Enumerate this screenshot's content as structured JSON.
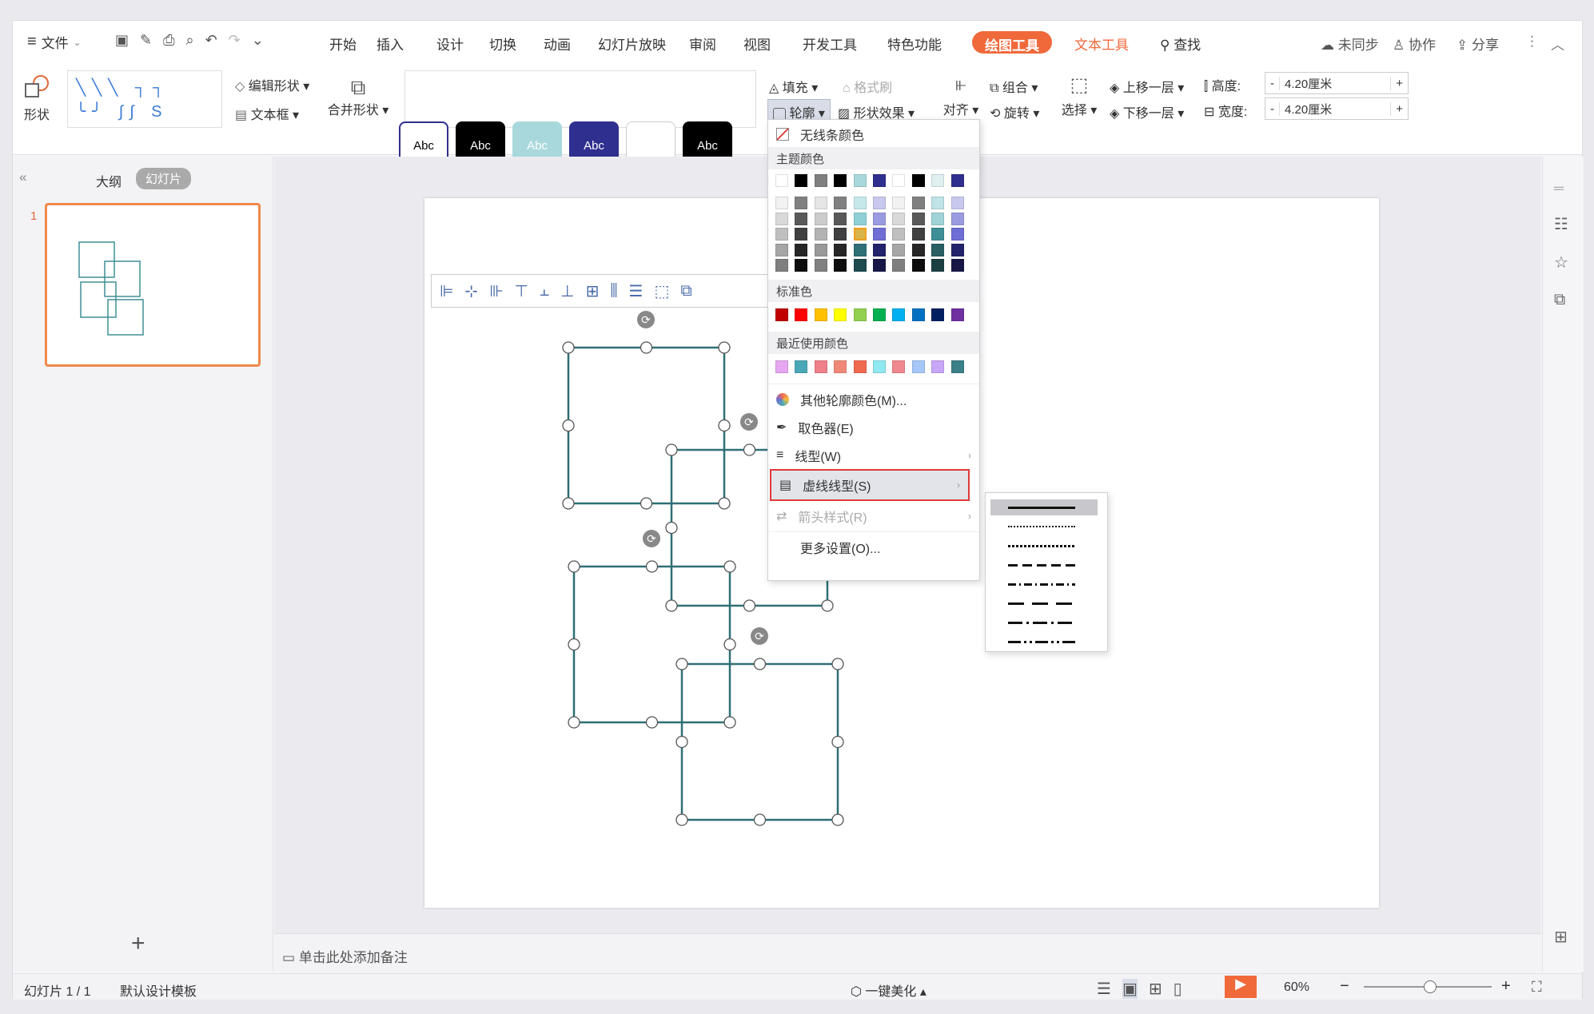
{
  "tabs": {
    "file": "文件",
    "items": [
      "开始",
      "插入",
      "设计",
      "切换",
      "动画",
      "幻灯片放映",
      "审阅",
      "视图",
      "开发工具",
      "特色功能"
    ],
    "drawing_tools": "绘图工具",
    "text_tools": "文本工具",
    "search": "查找",
    "unsync": "未同步",
    "collab": "协作",
    "share": "分享"
  },
  "ribbon": {
    "shape": "形状",
    "edit_shape": "编辑形状",
    "text_box": "文本框",
    "merge_shape": "合并形状",
    "style_label": "Abc",
    "fill": "填充",
    "format_painter": "格式刷",
    "outline": "轮廓",
    "shape_effect": "形状效果",
    "align": "对齐",
    "group": "组合",
    "rotate": "旋转",
    "select": "选择",
    "bring_forward": "上移一层",
    "send_backward": "下移一层",
    "height_label": "高度:",
    "width_label": "宽度:",
    "height_value": "4.20厘米",
    "width_value": "4.20厘米",
    "minus": "-",
    "plus": "+"
  },
  "style_colors": [
    "#ffffff",
    "#000000",
    "#a9d8dc",
    "#2f2f8f",
    "#ffffff",
    "#000000"
  ],
  "left_panel": {
    "outline_tab": "大纲",
    "slides_tab": "幻灯片",
    "slide_number": "1",
    "add": "+"
  },
  "notes_placeholder": "单击此处添加备注",
  "status": {
    "slide_count": "幻灯片 1 / 1",
    "template": "默认设计模板",
    "beautify": "一键美化",
    "zoom": "60%"
  },
  "outline_menu": {
    "no_line": "无线条颜色",
    "theme_colors": "主题颜色",
    "standard_colors": "标准色",
    "recent_colors": "最近使用颜色",
    "more_colors": "其他轮廓颜色(M)...",
    "eyedropper": "取色器(E)",
    "line_type": "线型(W)",
    "dash_type": "虚线线型(S)",
    "arrow_style": "箭头样式(R)",
    "more_settings": "更多设置(O)..."
  },
  "theme_top_row": [
    "#ffffff",
    "#000000",
    "#7f7f7f",
    "#000000",
    "#a9d8dc",
    "#2f2f8f",
    "#ffffff",
    "#000000",
    "#dfeff0",
    "#2f2f8f"
  ],
  "theme_shades": [
    [
      "#f2f2f2",
      "#808080",
      "#e6e6e6",
      "#808080",
      "#c7e8ea",
      "#c8c8ef",
      "#f2f2f2",
      "#808080",
      "#bfe3e6",
      "#c8c8ef"
    ],
    [
      "#d9d9d9",
      "#595959",
      "#cccccc",
      "#595959",
      "#8fd0d6",
      "#9b9be2",
      "#d9d9d9",
      "#595959",
      "#9fd3d8",
      "#9b9be2"
    ],
    [
      "#bfbfbf",
      "#404040",
      "#b3b3b3",
      "#404040",
      "#d9b44a",
      "#6e6ed4",
      "#bfbfbf",
      "#404040",
      "#3f8f96",
      "#6e6ed4"
    ],
    [
      "#a6a6a6",
      "#262626",
      "#999999",
      "#262626",
      "#2f6f75",
      "#23236b",
      "#a6a6a6",
      "#262626",
      "#2a5f64",
      "#23236b"
    ],
    [
      "#7f7f7f",
      "#0d0d0d",
      "#808080",
      "#0d0d0d",
      "#1f4a4e",
      "#171747",
      "#7f7f7f",
      "#0d0d0d",
      "#1c3f42",
      "#171747"
    ]
  ],
  "standard_colors": [
    "#c00000",
    "#ff0000",
    "#ffc000",
    "#ffff00",
    "#92d050",
    "#00b050",
    "#00b0f0",
    "#0070c0",
    "#002060",
    "#7030a0"
  ],
  "recent_colors": [
    "#e6a6f0",
    "#4aa8b8",
    "#f0808a",
    "#f08878",
    "#f06a50",
    "#90e8f0",
    "#f08890",
    "#a6c8f8",
    "#c8a6f8",
    "#3a8088"
  ]
}
